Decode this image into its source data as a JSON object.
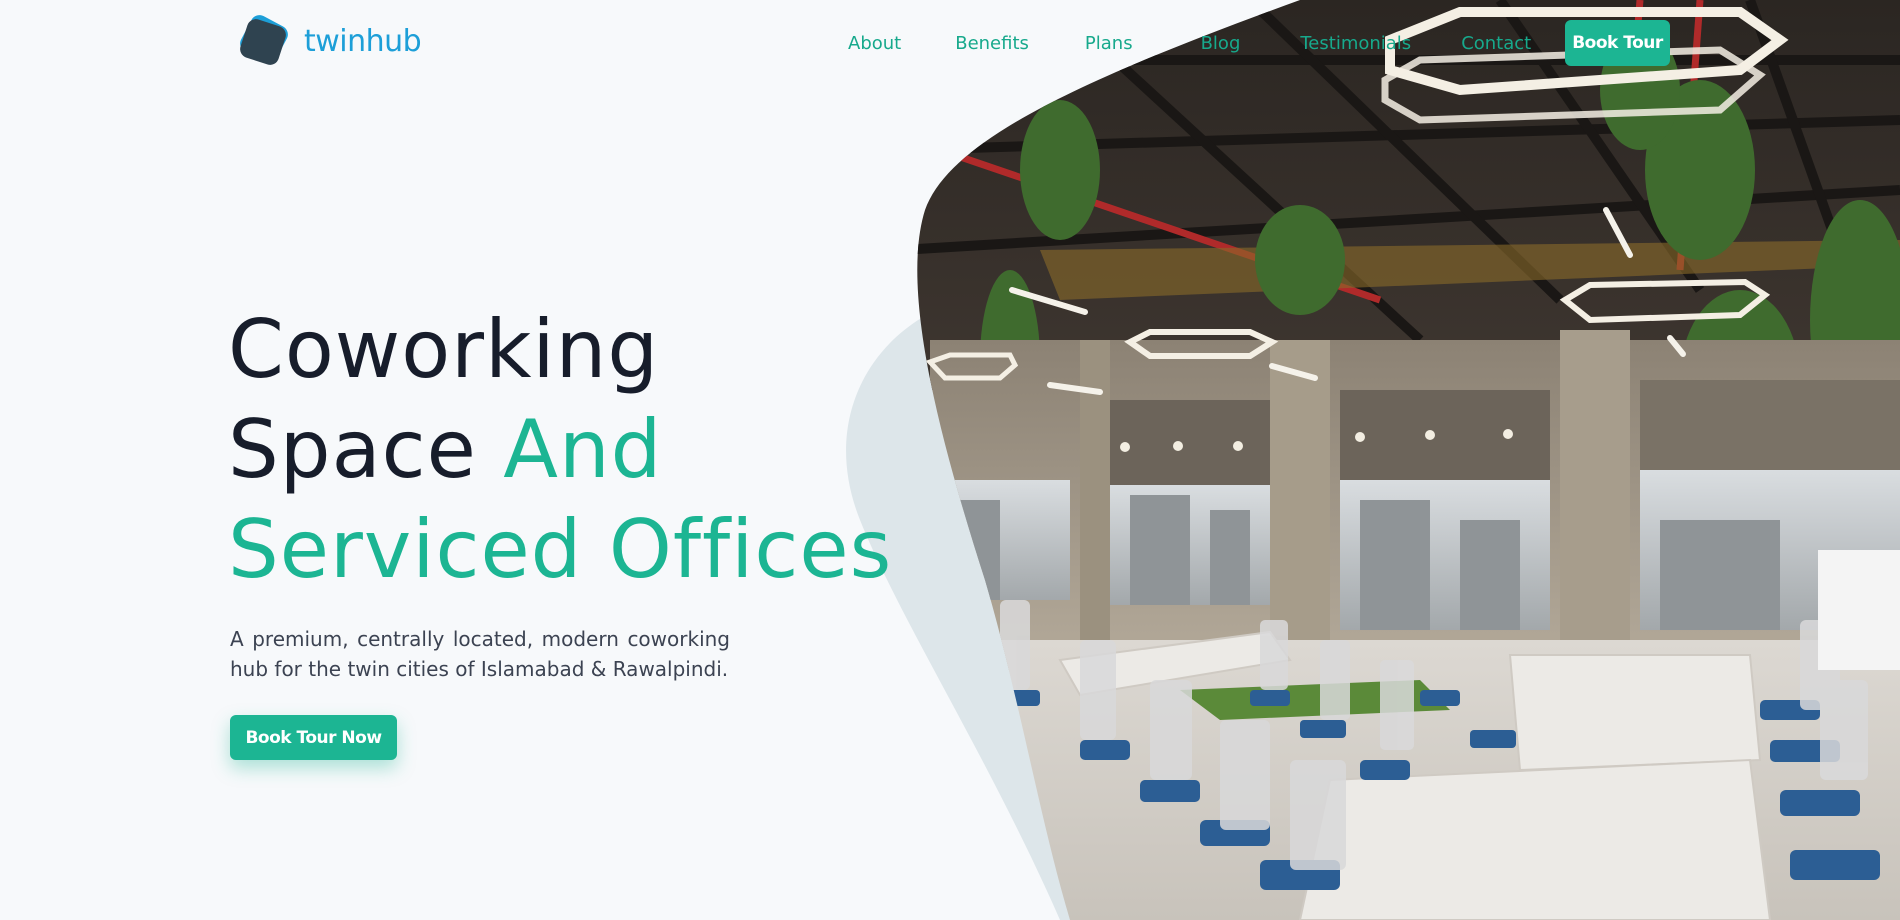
{
  "brand": {
    "name": "twinhub",
    "logo_icon": "rounded-diamond-logo-icon"
  },
  "nav": {
    "items": [
      {
        "label": "About"
      },
      {
        "label": "Benefits"
      },
      {
        "label": "Plans"
      },
      {
        "label": "Blog"
      },
      {
        "label": "Testimonials"
      },
      {
        "label": "Contact"
      }
    ],
    "cta_label": "Book Tour"
  },
  "hero": {
    "title_line1": "Coworking",
    "title_line2_dark": "Space ",
    "title_line2_accent": "And",
    "title_line3_accent": "Serviced Offices",
    "description": "A premium, centrally located, modern coworking hub for the twin cities of Islamabad & Rawalpindi.",
    "cta_label": "Book Tour Now",
    "image": "coworking-office-interior-photo"
  },
  "colors": {
    "accent": "#1cb593",
    "brand_blue": "#1d9fd8",
    "heading": "#171d2b",
    "background": "#f7f9fb"
  }
}
